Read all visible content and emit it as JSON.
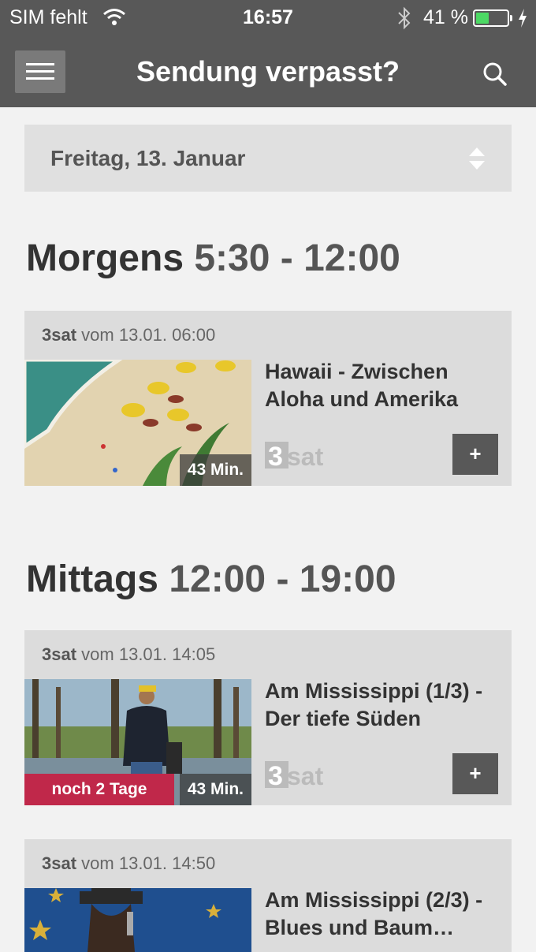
{
  "status_bar": {
    "carrier": "SIM fehlt",
    "time": "16:57",
    "battery_percent": "41 %",
    "battery_level": 0.41
  },
  "nav": {
    "title": "Sendung verpasst?",
    "menu_icon": "hamburger-menu-icon",
    "search_icon": "search-icon"
  },
  "date_selector": {
    "value": "Freitag, 13. Januar",
    "icon": "up-down-arrows-icon"
  },
  "sections": [
    {
      "name": "Morgens",
      "range": "5:30 - 12:00",
      "items": [
        {
          "channel": "3sat",
          "meta": "vom 13.01. 06:00",
          "title": "Hawaii - Zwischen Aloha und Amerika",
          "duration": "43 Min.",
          "logo_text": "3sat",
          "add_label": "+"
        }
      ]
    },
    {
      "name": "Mittags",
      "range": "12:00 - 19:00",
      "items": [
        {
          "channel": "3sat",
          "meta": "vom 13.01. 14:05",
          "title": "Am Mississippi (1/3) - Der tiefe Süden",
          "duration": "43 Min.",
          "expiry": "noch 2 Tage",
          "logo_text": "3sat",
          "add_label": "+"
        },
        {
          "channel": "3sat",
          "meta": "vom 13.01. 14:50",
          "title": "Am Mississippi (2/3) - Blues und Baum…"
        }
      ]
    }
  ],
  "colors": {
    "header": "#585858",
    "expiry_badge": "#c0284a",
    "battery_fill": "#4cd964"
  }
}
